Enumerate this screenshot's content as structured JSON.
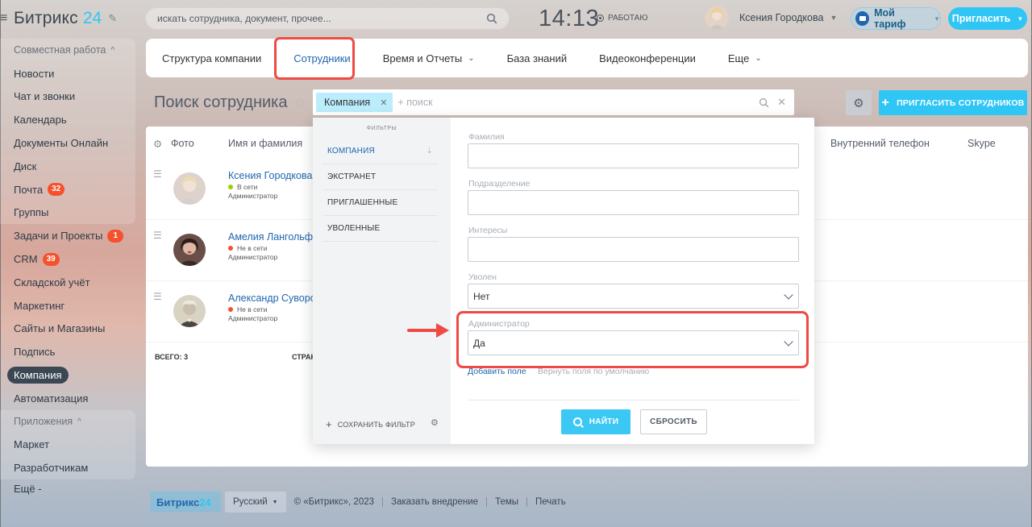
{
  "header": {
    "brand": "Битрикс",
    "brand_number": "24",
    "search_placeholder": "искать сотрудника, документ, прочее...",
    "time": "14:13",
    "work_status": "РАБОТАЮ",
    "user_name": "Ксения Городкова",
    "tariff_label": "Мой тариф",
    "invite_label": "Пригласить"
  },
  "sidebar": {
    "items": [
      {
        "label": "Совместная работа",
        "type": "section"
      },
      {
        "label": "Новости"
      },
      {
        "label": "Чат и звонки"
      },
      {
        "label": "Календарь"
      },
      {
        "label": "Документы Онлайн"
      },
      {
        "label": "Диск"
      },
      {
        "label": "Почта",
        "badge": "32"
      },
      {
        "label": "Группы"
      },
      {
        "label": "Задачи и Проекты",
        "badge": "1"
      },
      {
        "label": "CRM",
        "badge": "39"
      },
      {
        "label": "Складской учёт"
      },
      {
        "label": "Маркетинг"
      },
      {
        "label": "Сайты и Магазины"
      },
      {
        "label": "Подпись"
      },
      {
        "label": "Компания",
        "active": true
      },
      {
        "label": "Автоматизация"
      },
      {
        "label": "Приложения",
        "type": "section"
      },
      {
        "label": "Маркет"
      },
      {
        "label": "Разработчикам"
      },
      {
        "label": "Ещё -"
      }
    ]
  },
  "tabs": [
    {
      "label": "Структура компании"
    },
    {
      "label": "Сотрудники",
      "active": true
    },
    {
      "label": "Время и Отчеты",
      "dropdown": true
    },
    {
      "label": "База знаний"
    },
    {
      "label": "Видеоконференции"
    },
    {
      "label": "Еще",
      "dropdown": true
    }
  ],
  "page": {
    "title": "Поиск сотрудника",
    "filter_tag": "Компания",
    "filter_placeholder": "+ поиск",
    "invite_employees": "ПРИГЛАСИТЬ СОТРУДНИКОВ"
  },
  "grid": {
    "columns": {
      "photo": "Фото",
      "name": "Имя и фамилия",
      "phone": "Внутренний телефон",
      "skype": "Skype"
    },
    "rows": [
      {
        "name": "Ксения Городкова",
        "status": "В сети",
        "status_color": "#9dcf00",
        "role": "Администратор"
      },
      {
        "name": "Амелия Лангольф",
        "status": "Не в сети",
        "status_color": "#f4512c",
        "role": "Администратор"
      },
      {
        "name": "Александр Суворов",
        "status": "Не в сети",
        "status_color": "#f4512c",
        "role": "Администратор"
      }
    ],
    "total": "ВСЕГО: 3",
    "pages": "СТРАН"
  },
  "filter_popup": {
    "heading": "ФИЛЬТРЫ",
    "presets": [
      "КОМПАНИЯ",
      "ЭКСТРАНЕТ",
      "ПРИГЛАШЕННЫЕ",
      "УВОЛЕННЫЕ"
    ],
    "save_filter": "СОХРАНИТЬ ФИЛЬТР",
    "fields": {
      "lastname_label": "Фамилия",
      "department_label": "Подразделение",
      "interests_label": "Интересы",
      "fired_label": "Уволен",
      "fired_value": "Нет",
      "admin_label": "Администратор",
      "admin_value": "Да"
    },
    "add_field": "Добавить поле",
    "reset_fields": "Вернуть поля по умолчанию",
    "find": "НАЙТИ",
    "reset": "СБРОСИТЬ"
  },
  "footer": {
    "logo_text": "Битрикс",
    "logo_number": "24",
    "language": "Русский",
    "copyright": "© «Битрикс», 2023",
    "links": [
      "Заказать внедрение",
      "Темы",
      "Печать"
    ]
  },
  "colors": {
    "accent": "#2fc6f6",
    "link": "#2067b0",
    "highlight": "#ef4a44",
    "badge": "#f4512c"
  }
}
